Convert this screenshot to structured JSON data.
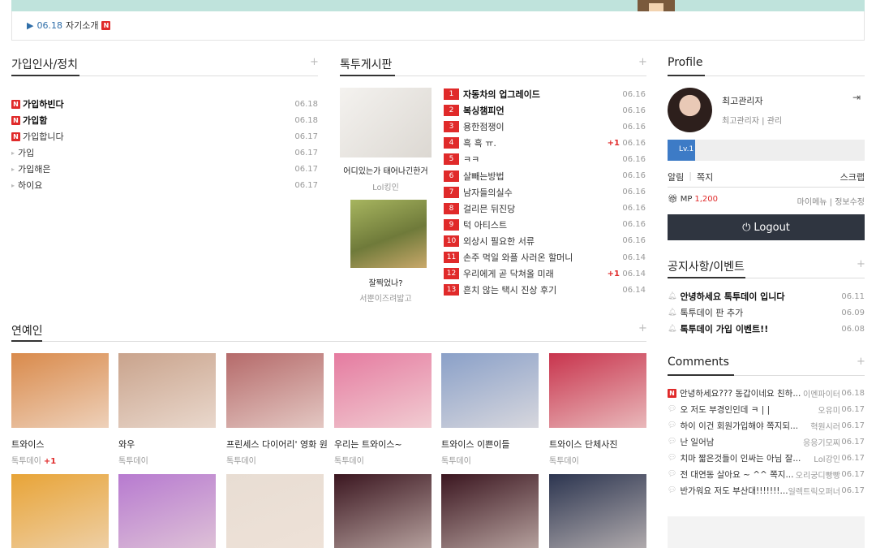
{
  "banner": {
    "date": "06.18",
    "text": "자기소개"
  },
  "left_board": {
    "title": "가입인사/정치",
    "items": [
      {
        "label": "가입하빈다",
        "date": "06.18",
        "new": true,
        "bold": true
      },
      {
        "label": "가입함",
        "date": "06.18",
        "new": true,
        "bold": true
      },
      {
        "label": "가입합니다",
        "date": "06.17",
        "new": true,
        "bold": false
      },
      {
        "label": "가입",
        "date": "06.17",
        "new": false,
        "bold": false
      },
      {
        "label": "가입해은",
        "date": "06.17",
        "new": false,
        "bold": false
      },
      {
        "label": "하이요",
        "date": "06.17",
        "new": false,
        "bold": false
      }
    ]
  },
  "middle_board": {
    "title": "톡투게시판",
    "thumbs": [
      {
        "caption": "어디있는가 태어나긴한거",
        "author": "Lol킹인"
      },
      {
        "caption": "잘찍었나?",
        "author": "서뿐이즈려밟고"
      }
    ],
    "items": [
      {
        "n": "1",
        "label": "자동차의 업그레이드",
        "date": "06.16",
        "bold": true,
        "plus": ""
      },
      {
        "n": "2",
        "label": "복싱챔피언",
        "date": "06.16",
        "bold": true,
        "plus": ""
      },
      {
        "n": "3",
        "label": "용한점쟁이",
        "date": "06.16",
        "bold": false,
        "plus": ""
      },
      {
        "n": "4",
        "label": "흑 흑 ㅠ.",
        "date": "06.16",
        "bold": false,
        "plus": "+1"
      },
      {
        "n": "5",
        "label": "ㅋㅋ",
        "date": "06.16",
        "bold": false,
        "plus": ""
      },
      {
        "n": "6",
        "label": "살빼는방법",
        "date": "06.16",
        "bold": false,
        "plus": ""
      },
      {
        "n": "7",
        "label": "남자들의실수",
        "date": "06.16",
        "bold": false,
        "plus": ""
      },
      {
        "n": "8",
        "label": "걸리믄 뒤진당",
        "date": "06.16",
        "bold": false,
        "plus": ""
      },
      {
        "n": "9",
        "label": "턱 아티스트",
        "date": "06.16",
        "bold": false,
        "plus": ""
      },
      {
        "n": "10",
        "label": "외상시 필요한 서류",
        "date": "06.16",
        "bold": false,
        "plus": ""
      },
      {
        "n": "11",
        "label": "손주 먹일 와플 사러온 할머니",
        "date": "06.14",
        "bold": false,
        "plus": ""
      },
      {
        "n": "12",
        "label": "우리에게 곧 닥쳐올 미래",
        "date": "06.14",
        "bold": false,
        "plus": "+1"
      },
      {
        "n": "13",
        "label": "흔치 않는 택시 진상 후기",
        "date": "06.14",
        "bold": false,
        "plus": ""
      }
    ]
  },
  "celeb": {
    "title": "연예인",
    "row1": [
      {
        "caption": "트와이스",
        "sub": "톡투데이",
        "plus": "+1",
        "color": "#d98a4b"
      },
      {
        "caption": "와우",
        "sub": "톡투데이",
        "plus": "",
        "color": "#c9a38c"
      },
      {
        "caption": "프린세스 다이어리' 영화 원",
        "sub": "톡투데이",
        "plus": "",
        "color": "#b56a6a"
      },
      {
        "caption": "우리는 트와이스~",
        "sub": "톡투데이",
        "plus": "",
        "color": "#e57ba0"
      },
      {
        "caption": "트와이스 이쁜이들",
        "sub": "톡투데이",
        "plus": "",
        "color": "#8aa0c8"
      },
      {
        "caption": "트와이스 단체사진",
        "sub": "톡투데이",
        "plus": "",
        "color": "#c8344d"
      }
    ],
    "row2": [
      {
        "color": "#e8a437"
      },
      {
        "color": "#b77ad0"
      },
      {
        "color": "#e8ddd3"
      },
      {
        "color": "#3b1620"
      },
      {
        "color": "#3b1620"
      },
      {
        "color": "#2c3550"
      }
    ]
  },
  "profile": {
    "title": "Profile",
    "name": "최고관리자",
    "role": "최고관리자 | 관리",
    "level": "Lv.1",
    "level_fraction": 0.14,
    "links": [
      "알림",
      "쪽지",
      "스크랩"
    ],
    "mp_label": "MP",
    "mp_value": "1,200",
    "menu": "마이메뉴 | 정보수정",
    "logout": "Logout"
  },
  "notice": {
    "title": "공지사항/이벤트",
    "items": [
      {
        "label": "안녕하세요 톡투데이 입니다",
        "date": "06.11",
        "bold": true
      },
      {
        "label": "톡투데이 판 추가",
        "date": "06.09",
        "bold": false
      },
      {
        "label": "톡투데이 가입 이벤트!!",
        "date": "06.08",
        "bold": true
      }
    ]
  },
  "comments": {
    "title": "Comments",
    "items": [
      {
        "label": "안녕하세요??? 동갑이네요 친하...",
        "author": "이멘파이터",
        "date": "06.18",
        "new": true
      },
      {
        "label": "오 저도 부경인인데 ㅋ | |",
        "author": "오유미",
        "date": "06.17",
        "new": false
      },
      {
        "label": "하이 이건 회원가입해야 쪽지되...",
        "author": "혁원시러",
        "date": "06.17",
        "new": false
      },
      {
        "label": "난 일어남",
        "author": "응응기모찌",
        "date": "06.17",
        "new": false
      },
      {
        "label": "치마 짧은것들이 인싸는 아님 잘...",
        "author": "Lol강인",
        "date": "06.17",
        "new": false
      },
      {
        "label": "전 대연동 살아요 ~ ^^ 쪽지...",
        "author": "오리궁디빵빵",
        "date": "06.17",
        "new": false
      },
      {
        "label": "반가워요 저도 부산대!!!!!!!...",
        "author": "일렉트릭오퍼너",
        "date": "06.17",
        "new": false
      }
    ]
  },
  "colors": {
    "accent": "#e02a2a",
    "link": "#2f6ea8",
    "dark_button": "#2f3540",
    "level_bar": "#3d7bc6"
  }
}
